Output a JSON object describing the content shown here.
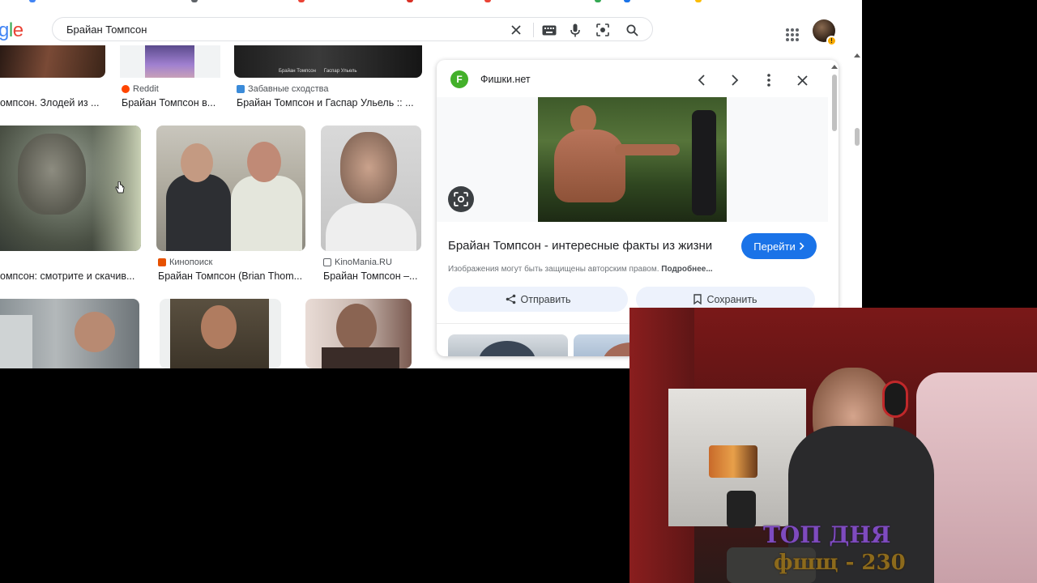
{
  "browser": {
    "search": {
      "logo_text": "gle",
      "query": "Брайан Томпсон"
    }
  },
  "results": {
    "row1": [
      {
        "source": "",
        "title": "омпсон. Злодей из ..."
      },
      {
        "source": "Reddit",
        "title": "Брайан Томпсон в..."
      },
      {
        "source": "Забавные сходства",
        "title": "Брайан Томпсон и Гаспар Ульель :: ..."
      }
    ],
    "row1_image_caption": "Брайан Томпсон      Гаспар Ульель",
    "row2": [
      {
        "source": "",
        "title": "омпсон: смотрите и скачив..."
      },
      {
        "source": "Кинопоиск",
        "title": "Брайан Томпсон (Brian Thom..."
      },
      {
        "source": "KinoMania.RU",
        "title": "Брайан Томпсон –..."
      }
    ]
  },
  "panel": {
    "site_initial": "F",
    "site_name": "Фишки.нет",
    "title": "Брайан Томпсон - интересные факты из жизни",
    "visit_label": "Перейти",
    "copyright_text": "Изображения могут быть защищены авторским правом.",
    "copyright_link": "Подробнее...",
    "share_label": "Отправить",
    "save_label": "Сохранить"
  },
  "stream_overlay": {
    "line1": "ТОП ДНЯ",
    "line2": "фшщ - 230"
  },
  "colors": {
    "google_blue": "#1a73e8",
    "site_icon_green": "#43b02a",
    "overlay_purple": "#7e4bbf",
    "overlay_gold": "#8c6a1c"
  }
}
